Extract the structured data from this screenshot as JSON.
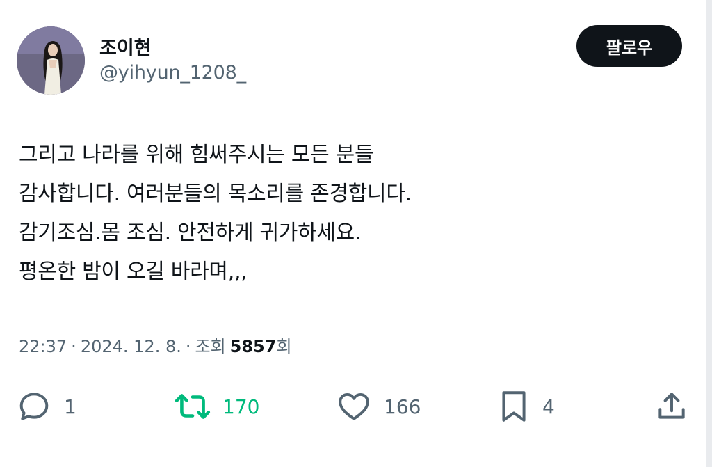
{
  "profile": {
    "display_name": "조이현",
    "handle": "@yihyun_1208_"
  },
  "follow_button": {
    "label": "팔로우"
  },
  "tweet": {
    "lines": [
      "그리고 나라를 위해 힘써주시는 모든 분들",
      "감사합니다. 여러분들의 목소리를 존경합니다.",
      "감기조심.몸 조심. 안전하게 귀가하세요.",
      "평온한 밤이 오길 바라며,,,"
    ]
  },
  "meta": {
    "time": "22:37",
    "separator": "·",
    "date": "2024. 12. 8.",
    "views_label": "조회",
    "views_count": "5857",
    "views_suffix": "회"
  },
  "actions": {
    "reply_count": "1",
    "retweet_count": "170",
    "like_count": "166",
    "bookmark_count": "4"
  },
  "icons": {
    "reply": "reply-icon",
    "retweet": "retweet-icon",
    "like": "heart-icon",
    "bookmark": "bookmark-icon",
    "share": "share-icon"
  },
  "colors": {
    "text_primary": "#0f1419",
    "text_secondary": "#536471",
    "retweet_active": "#00ba7c",
    "follow_button_bg": "#0f1419",
    "follow_button_text": "#ffffff"
  }
}
